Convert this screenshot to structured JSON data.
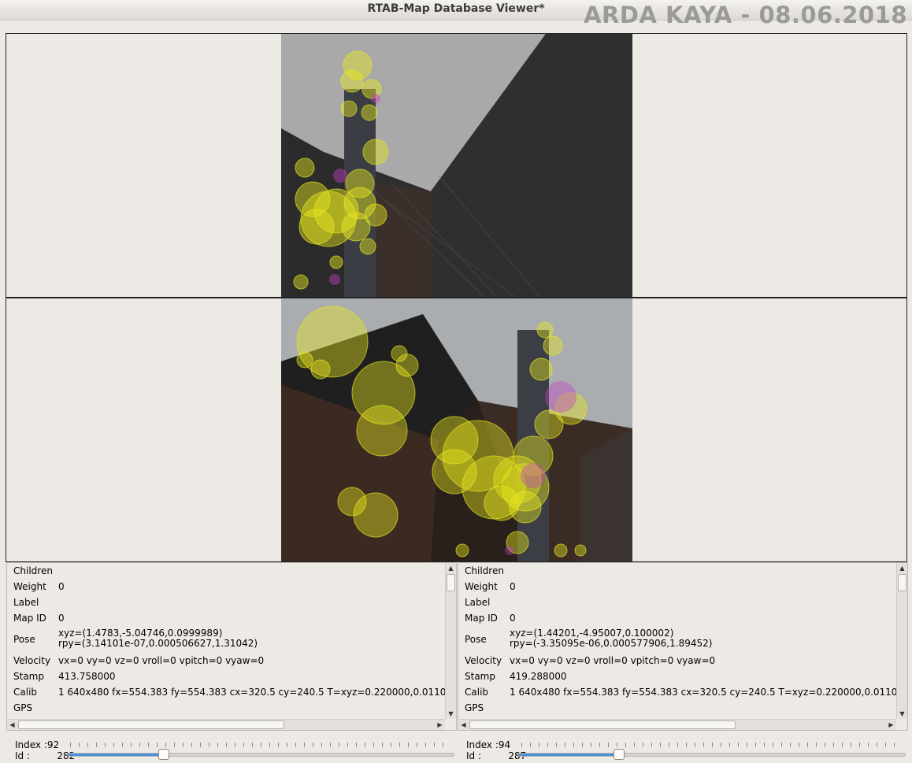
{
  "window": {
    "title": "RTAB-Map Database Viewer*"
  },
  "watermark": "ARDA KAYA - 08.06.2018",
  "panels": {
    "left": {
      "rows": [
        {
          "key": "Children",
          "value": ""
        },
        {
          "key": "Weight",
          "value": "0"
        },
        {
          "key": "Label",
          "value": ""
        },
        {
          "key": "Map ID",
          "value": "0"
        },
        {
          "key": "Pose",
          "value": "xyz=(1.4783,-5.04746,0.0999989)",
          "value2": "rpy=(3.14101e-07,0.000506627,1.31042)"
        },
        {
          "key": "Velocity",
          "value": "vx=0 vy=0 vz=0 vroll=0 vpitch=0 vyaw=0"
        },
        {
          "key": "Stamp",
          "value": "413.758000"
        },
        {
          "key": "Calib",
          "value": "1 640x480 fx=554.383 fy=554.383 cx=320.5 cy=240.5 T=xyz=0.220000,0.0110"
        },
        {
          "key": "GPS",
          "value": ""
        }
      ]
    },
    "right": {
      "rows": [
        {
          "key": "Children",
          "value": ""
        },
        {
          "key": "Weight",
          "value": "0"
        },
        {
          "key": "Label",
          "value": ""
        },
        {
          "key": "Map ID",
          "value": "0"
        },
        {
          "key": "Pose",
          "value": "xyz=(1.44201,-4.95007,0.100002)",
          "value2": "rpy=(-3.35095e-06,0.000577906,1.89452)"
        },
        {
          "key": "Velocity",
          "value": "vx=0 vy=0 vz=0 vroll=0 vpitch=0 vyaw=0"
        },
        {
          "key": "Stamp",
          "value": "419.288000"
        },
        {
          "key": "Calib",
          "value": "1 640x480 fx=554.383 fy=554.383 cx=320.5 cy=240.5 T=xyz=0.220000,0.0110"
        },
        {
          "key": "GPS",
          "value": ""
        }
      ]
    }
  },
  "controls": {
    "left": {
      "index_label": "Index :",
      "index_value": "92",
      "id_label": "Id :",
      "id_value": "282",
      "slider_fraction": 0.25
    },
    "right": {
      "index_label": "Index :",
      "index_value": "94",
      "id_label": "Id :",
      "id_value": "287",
      "slider_fraction": 0.26
    }
  },
  "colors": {
    "feature": "#e6e61e",
    "feature_alt": "#c040c0",
    "slider_accent": "#4a90d9"
  },
  "icons": {
    "scroll_up": "up-arrow-icon",
    "scroll_down": "down-arrow-icon",
    "scroll_left": "left-arrow-icon",
    "scroll_right": "right-arrow-icon"
  }
}
